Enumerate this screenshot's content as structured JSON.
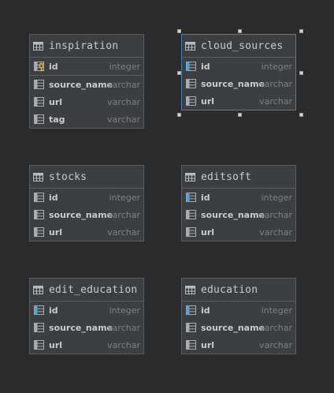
{
  "tables": {
    "inspiration": {
      "name": "inspiration",
      "columns": [
        {
          "name": "id",
          "type": "integer"
        },
        {
          "name": "source_name",
          "type": "varchar"
        },
        {
          "name": "url",
          "type": "varchar"
        },
        {
          "name": "tag",
          "type": "varchar"
        }
      ]
    },
    "cloud_sources": {
      "name": "cloud_sources",
      "columns": [
        {
          "name": "id",
          "type": "integer"
        },
        {
          "name": "source_name",
          "type": "varchar"
        },
        {
          "name": "url",
          "type": "varchar"
        }
      ]
    },
    "stocks": {
      "name": "stocks",
      "columns": [
        {
          "name": "id",
          "type": "integer"
        },
        {
          "name": "source_name",
          "type": "varchar"
        },
        {
          "name": "url",
          "type": "varchar"
        }
      ]
    },
    "editsoft": {
      "name": "editsoft",
      "columns": [
        {
          "name": "id",
          "type": "integer"
        },
        {
          "name": "source_name",
          "type": "varchar"
        },
        {
          "name": "url",
          "type": "varchar"
        }
      ]
    },
    "edit_education": {
      "name": "edit_education",
      "columns": [
        {
          "name": "id",
          "type": "integer"
        },
        {
          "name": "source_name",
          "type": "varchar"
        },
        {
          "name": "url",
          "type": "varchar"
        }
      ]
    },
    "education": {
      "name": "education",
      "columns": [
        {
          "name": "id",
          "type": "integer"
        },
        {
          "name": "source_name",
          "type": "varchar"
        },
        {
          "name": "url",
          "type": "varchar"
        }
      ]
    }
  },
  "selected_table": "cloud_sources",
  "colors": {
    "background": "#2b2b2b",
    "table_fill": "#3c3f41",
    "table_border": "#5a5d5f",
    "selection_border": "#4a78c2",
    "text": "#c9cbcc",
    "type_text": "#7e8183",
    "key_gold": "#d7a83a",
    "key_blue": "#4fa4d8"
  },
  "icons": {
    "table": "table-icon",
    "column": "column-icon",
    "primary_key": "primary-key-column-icon",
    "id_column": "id-column-icon"
  }
}
